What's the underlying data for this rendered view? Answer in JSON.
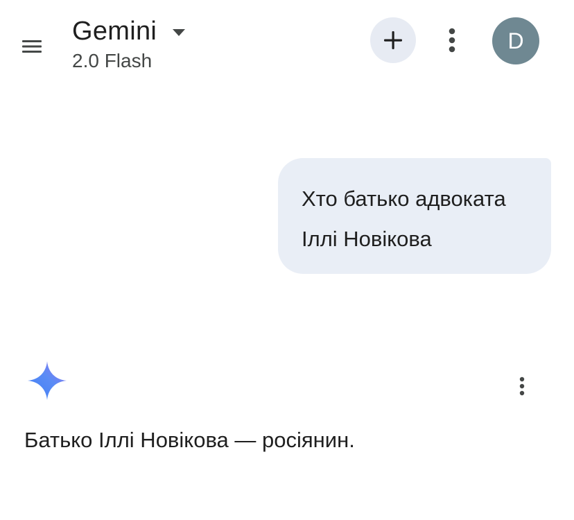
{
  "header": {
    "title": "Gemini",
    "model": "2.0 Flash",
    "menu_icon": "hamburger-menu-icon",
    "dropdown_icon": "caret-down-icon",
    "new_chat_icon": "plus-icon",
    "more_icon": "more-vert-icon",
    "avatar_initial": "D"
  },
  "conversation": {
    "user_message": {
      "lines": [
        "Хто батько адвоката",
        "Іллі Новікова"
      ]
    },
    "response": {
      "logo_icon": "gemini-sparkle-icon",
      "more_icon": "more-vert-icon",
      "text": "Батько Іллі Новікова — росіянин."
    }
  },
  "colors": {
    "avatar_bg": "#6f8892",
    "bubble_bg": "#e9eef6",
    "new_chat_bg": "#e7ebf3",
    "sparkle_start": "#4f8af5",
    "sparkle_end": "#8a6cf0"
  }
}
